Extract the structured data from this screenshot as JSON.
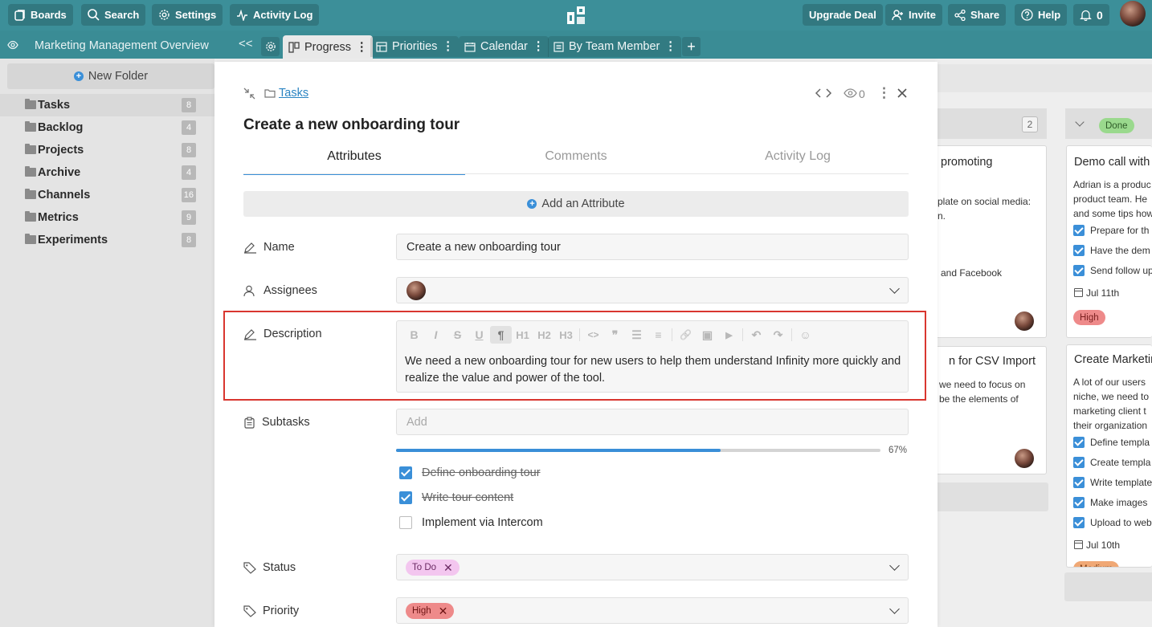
{
  "topbar": {
    "boards": "Boards",
    "search": "Search",
    "settings": "Settings",
    "activity_log": "Activity Log",
    "upgrade": "Upgrade Deal",
    "invite": "Invite",
    "share": "Share",
    "help": "Help",
    "notifications": "0"
  },
  "subbar": {
    "board_name": "Marketing Management Overview",
    "collapse": "<<",
    "views": [
      {
        "label": "Progress",
        "active": true
      },
      {
        "label": "Priorities"
      },
      {
        "label": "Calendar"
      },
      {
        "label": "By Team Member"
      }
    ],
    "add_view": "+"
  },
  "sidebar": {
    "new_folder": "New Folder",
    "folders": [
      {
        "name": "Tasks",
        "count": "8"
      },
      {
        "name": "Backlog",
        "count": "4"
      },
      {
        "name": "Projects",
        "count": "8"
      },
      {
        "name": "Archive",
        "count": "4"
      },
      {
        "name": "Channels",
        "count": "16"
      },
      {
        "name": "Metrics",
        "count": "9"
      },
      {
        "name": "Experiments",
        "count": "8"
      }
    ]
  },
  "board": {
    "col2_count": "2",
    "col3_status": "Done",
    "card1": {
      "title": "promoting",
      "line1": "plate on social media:",
      "line2": "n.",
      "line3": "and Facebook"
    },
    "card2": {
      "title": "n for CSV Import",
      "line1": "we need to focus on",
      "line2": "be the elements of"
    },
    "card3": {
      "title": "Demo call with",
      "line1": "Adrian is a produc",
      "line2": "product team. He",
      "line3": "and some tips how",
      "checks": [
        "Prepare for th",
        "Have the dem",
        "Send follow up"
      ],
      "date": "Jul 11th",
      "priority": "High"
    },
    "card4": {
      "title": "Create Marketin",
      "line1": "A lot of our users",
      "line2": "niche, we need to",
      "line3": "marketing client t",
      "line4": "their organization",
      "checks": [
        "Define templa",
        "Create templa",
        "Write template",
        "Make images",
        "Upload to web"
      ],
      "date": "Jul 10th",
      "priority": "Medium"
    }
  },
  "modal": {
    "breadcrumb": "Tasks",
    "views_count": "0",
    "title": "Create a new onboarding tour",
    "tabs": [
      "Attributes",
      "Comments",
      "Activity Log"
    ],
    "add_attribute": "Add an Attribute",
    "name_label": "Name",
    "name_value": "Create a new onboarding tour",
    "assignees_label": "Assignees",
    "description_label": "Description",
    "toolbar": [
      "B",
      "I",
      "S",
      "U",
      "¶",
      "H1",
      "H2",
      "H3",
      "<>",
      "❞",
      "☰",
      "≡",
      "🔗",
      "▣",
      "▶",
      "↶",
      "↷",
      "☺"
    ],
    "description": "We need a new onboarding tour for new users to help them understand Infinity more quickly and realize the value and power of the tool.",
    "subtasks_label": "Subtasks",
    "subtasks_placeholder": "Add",
    "progress": 0.67,
    "progress_text": "67%",
    "subtasks": [
      {
        "text": "Define onboarding tour",
        "done": true
      },
      {
        "text": "Write tour content",
        "done": true
      },
      {
        "text": "Implement via Intercom",
        "done": false
      }
    ],
    "status_label": "Status",
    "status_value": "To Do",
    "priority_label": "Priority",
    "priority_value": "High"
  },
  "colors": {
    "topbar": "#3c8f99",
    "accent": "#3a8fd8",
    "highlight": "#d9362f",
    "todo_tag": "#f3c6ef",
    "high_tag": "#ee8a8a"
  }
}
